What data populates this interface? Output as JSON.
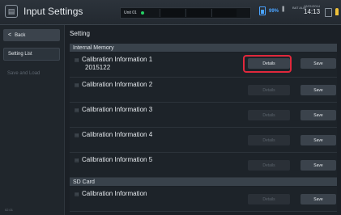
{
  "header": {
    "title": "Input Settings",
    "unit_label": "Unit 01",
    "battery": "99%",
    "small_label": "BAT ALM",
    "date": "12/21/2014",
    "time": "14:13"
  },
  "sidebar": {
    "back_label": "Back",
    "items": [
      {
        "label": "Setting List"
      },
      {
        "label": "Save and Load"
      }
    ],
    "version": "02.01"
  },
  "main": {
    "title": "Setting",
    "sections": [
      {
        "header": "Internal Memory",
        "rows": [
          {
            "name": "Calibration Information 1",
            "sub": "2015122"
          },
          {
            "name": "Calibration Information 2"
          },
          {
            "name": "Calibration Information 3"
          },
          {
            "name": "Calibration Information 4"
          },
          {
            "name": "Calibration Information 5"
          }
        ]
      },
      {
        "header": "SD Card",
        "rows": [
          {
            "name": "Calibration Information"
          }
        ]
      }
    ],
    "details_label": "Details",
    "save_label": "Save"
  }
}
